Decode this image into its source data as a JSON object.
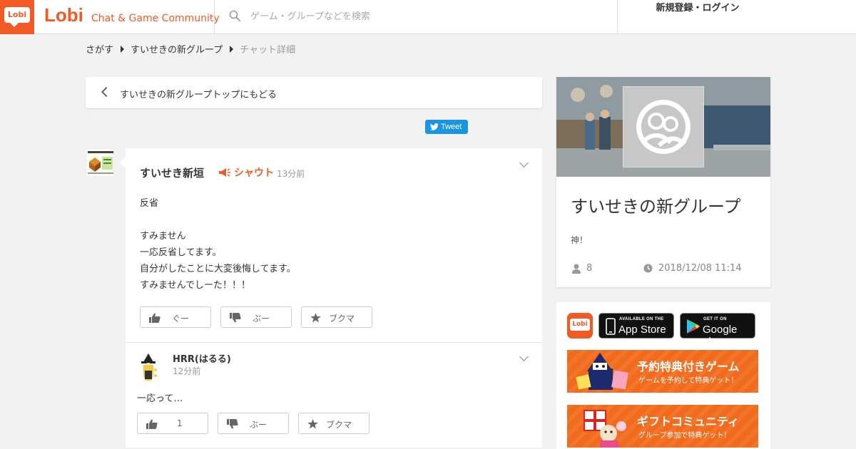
{
  "header": {
    "logo_text": "Lobi",
    "brand": "Lobi",
    "tagline": "Chat & Game Community",
    "search_placeholder": "ゲーム・グループなどを検索",
    "login": "新規登録・ログイン"
  },
  "breadcrumb": [
    "さがす",
    "すいせきの新グループ",
    "チャット詳細"
  ],
  "back_link": "すいせきの新グループトップにもどる",
  "tweet": "Tweet",
  "post": {
    "author": "すいせき新垣",
    "shout": "シャウト",
    "time": "13分前",
    "body": "反省\n\nすみません\n一応反省してます。\n自分がしたことに大変後悔してます。\nすみませんでしーた！！！",
    "actions": {
      "like": "ぐー",
      "dislike": "ぶー",
      "bookmark": "ブクマ"
    }
  },
  "reply": {
    "author": "HRR(はるる)",
    "time": "12分前",
    "body": "一応って…",
    "actions": {
      "like": "1",
      "dislike": "ぶー",
      "bookmark": "ブクマ"
    }
  },
  "group": {
    "name": "すいせきの新グループ",
    "description": "神！",
    "members": "8",
    "date": "2018/12/08  11:14"
  },
  "promo": {
    "app_lobi": "Lobi",
    "appstore_small": "AVAILABLE ON THE",
    "appstore_big": "App Store",
    "googleplay_small": "GET IT ON",
    "googleplay_big": "Google play",
    "banner1_title": "予約特典付きゲーム",
    "banner1_sub": "ゲームを予約して特典ゲット！",
    "banner2_title": "ギフトコミュニティ",
    "banner2_sub": "グループ参加で特典ゲット！"
  },
  "colors": {
    "accent": "#f15a24",
    "twitter": "#1b95e0"
  }
}
